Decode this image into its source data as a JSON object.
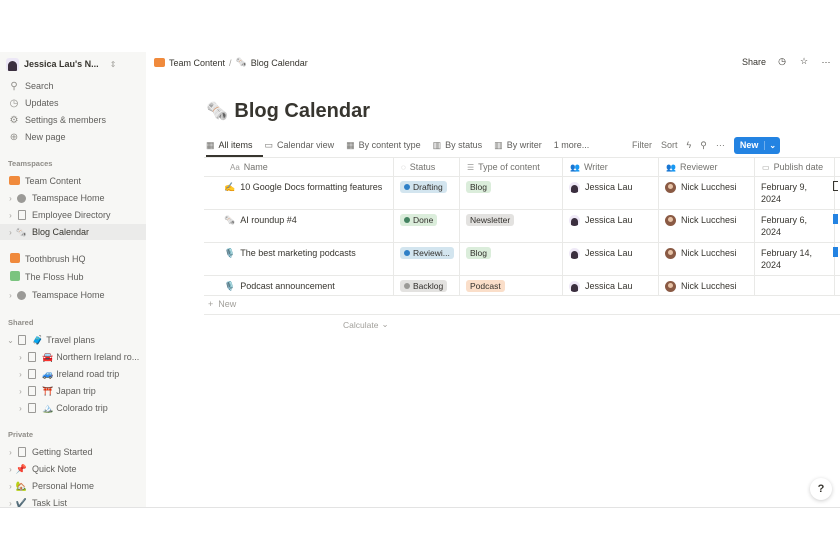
{
  "workspace": {
    "name": "Jessica Lau's N...",
    "switch_icon": "chevron-up-down"
  },
  "sidebar": {
    "nav": [
      {
        "label": "Search",
        "icon": "search-icon"
      },
      {
        "label": "Updates",
        "icon": "clock-icon"
      },
      {
        "label": "Settings & members",
        "icon": "gear-icon"
      },
      {
        "label": "New page",
        "icon": "plus-circle-icon"
      }
    ],
    "teamspaces_label": "Teamspaces",
    "teamspaces": [
      {
        "label": "Team Content",
        "icon": "team-content-icon",
        "level": 0
      },
      {
        "label": "Teamspace Home",
        "icon": "compass-icon",
        "level": 1
      },
      {
        "label": "Employee Directory",
        "icon": "page-icon",
        "level": 1
      },
      {
        "label": "Blog Calendar",
        "icon": "newspaper-icon",
        "level": 1,
        "active": true
      },
      {
        "label": "Toothbrush HQ",
        "icon": "toothbrush-icon",
        "level": 0
      },
      {
        "label": "The Floss Hub",
        "icon": "floss-icon",
        "level": 0
      },
      {
        "label": "Teamspace Home",
        "icon": "compass-icon",
        "level": 1
      }
    ],
    "shared_label": "Shared",
    "shared": [
      {
        "label": "Travel plans",
        "emoji": "🧳",
        "level": 0
      },
      {
        "label": "Northern Ireland ro...",
        "emoji": "🚘",
        "level": 1
      },
      {
        "label": "Ireland road trip",
        "emoji": "🚙",
        "level": 1
      },
      {
        "label": "Japan trip",
        "emoji": "⛩️",
        "level": 1
      },
      {
        "label": "Colorado trip",
        "emoji": "🏔️",
        "level": 1
      }
    ],
    "private_label": "Private",
    "private": [
      {
        "label": "Getting Started",
        "icon": "page-icon"
      },
      {
        "label": "Quick Note",
        "emoji": "📌"
      },
      {
        "label": "Personal Home",
        "emoji": "🏡"
      },
      {
        "label": "Task List",
        "emoji": "✔️"
      }
    ]
  },
  "breadcrumb": {
    "parent": "Team Content",
    "separator": "/",
    "current": "Blog Calendar"
  },
  "topbar": {
    "share": "Share"
  },
  "page": {
    "emoji": "🗞️",
    "title": "Blog Calendar"
  },
  "views": [
    {
      "label": "All items",
      "icon": "table-icon",
      "active": true
    },
    {
      "label": "Calendar view",
      "icon": "calendar-icon"
    },
    {
      "label": "By content type",
      "icon": "table-icon"
    },
    {
      "label": "By status",
      "icon": "board-icon"
    },
    {
      "label": "By writer",
      "icon": "board-icon"
    },
    {
      "label": "1 more...",
      "icon": ""
    }
  ],
  "toolbar": {
    "filter": "Filter",
    "sort": "Sort",
    "more": "···",
    "new": "New"
  },
  "columns": [
    {
      "label": "Name",
      "icon": "Aa"
    },
    {
      "label": "Status",
      "icon": "status-icon"
    },
    {
      "label": "Type of content",
      "icon": "list-icon"
    },
    {
      "label": "Writer",
      "icon": "people-icon"
    },
    {
      "label": "Reviewer",
      "icon": "people-icon"
    },
    {
      "label": "Publish date",
      "icon": "calendar-icon"
    }
  ],
  "rows": [
    {
      "emoji": "✍️",
      "name": "10 Google Docs formatting features",
      "status": "Drafting",
      "type": "Blog",
      "writer": "Jessica Lau",
      "reviewer": "Nick Lucchesi",
      "date_l1": "February 9,",
      "date_l2": "2024"
    },
    {
      "emoji": "🗞️",
      "name": "AI roundup #4",
      "status": "Done",
      "type": "Newsletter",
      "writer": "Jessica Lau",
      "reviewer": "Nick Lucchesi",
      "date_l1": "February 6,",
      "date_l2": "2024"
    },
    {
      "emoji": "🎙️",
      "name": "The best marketing podcasts",
      "status": "Reviewi...",
      "type": "Blog",
      "writer": "Jessica Lau",
      "reviewer": "Nick Lucchesi",
      "date_l1": "February 14,",
      "date_l2": "2024"
    },
    {
      "emoji": "🎙️",
      "name": "Podcast announcement",
      "status": "Backlog",
      "type": "Podcast",
      "writer": "Jessica Lau",
      "reviewer": "Nick Lucchesi",
      "date_l1": "",
      "date_l2": ""
    }
  ],
  "status_colors": {
    "Drafting": {
      "bg": "#d3e5ef",
      "dot": "#2f80c7"
    },
    "Done": {
      "bg": "#dbeddb",
      "dot": "#448361"
    },
    "Reviewi...": {
      "bg": "#d3e5ef",
      "dot": "#2f80c7"
    },
    "Backlog": {
      "bg": "#e3e2e0",
      "dot": "#9b9a97"
    }
  },
  "type_colors": {
    "Blog": "#dbeddb",
    "Newsletter": "#e3e2e0",
    "Podcast": "#fadec9"
  },
  "footer": {
    "new_row": "New",
    "calculate": "Calculate"
  },
  "help": "?"
}
